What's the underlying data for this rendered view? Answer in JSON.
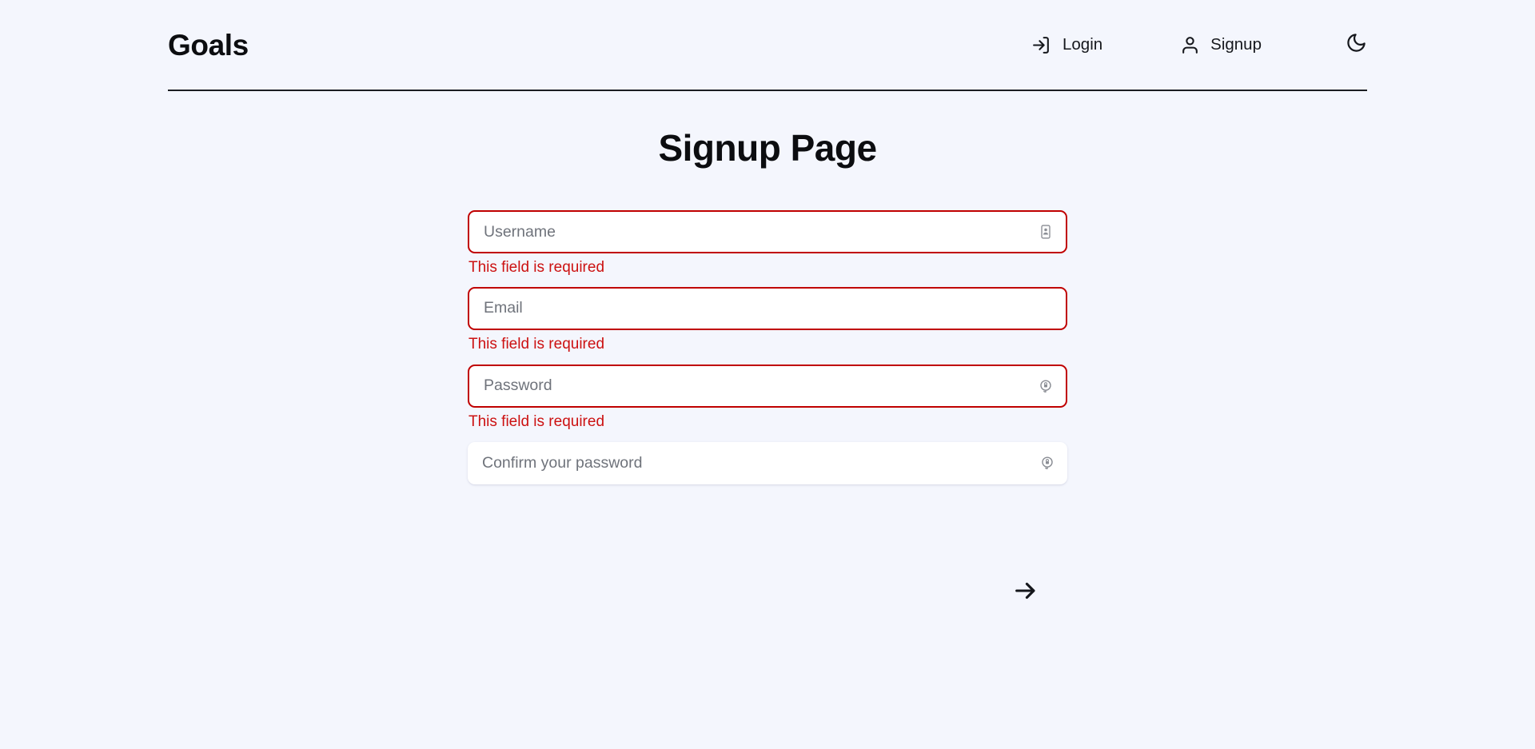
{
  "theme": {
    "background": "#f4f6fd",
    "surface": "#ffffff",
    "text": "#0c0d10",
    "error_border": "#c00000",
    "error_text": "#cc1111",
    "placeholder": "#6f737b",
    "divider": "#1b1d22"
  },
  "header": {
    "brand": "Goals",
    "nav": [
      {
        "label": "Login",
        "icon": "log-in-icon"
      },
      {
        "label": "Signup",
        "icon": "user-icon"
      }
    ],
    "theme_toggle": {
      "icon": "moon-icon",
      "label": "Dark mode"
    }
  },
  "main": {
    "title": "Signup Page",
    "fields": [
      {
        "name": "username",
        "placeholder": "Username",
        "value": "",
        "type": "text",
        "state": "error",
        "error": "This field is required",
        "affordance_icon": "contact-card-icon"
      },
      {
        "name": "email",
        "placeholder": "Email",
        "value": "",
        "type": "email",
        "state": "error",
        "error": "This field is required",
        "affordance_icon": ""
      },
      {
        "name": "password",
        "placeholder": "Password",
        "value": "",
        "type": "password",
        "state": "error",
        "error": "This field is required",
        "affordance_icon": "key-autofill-icon"
      },
      {
        "name": "confirm-password",
        "placeholder": "Confirm your password",
        "value": "",
        "type": "password",
        "state": "ok",
        "error": "",
        "affordance_icon": "key-autofill-icon"
      }
    ],
    "submit": {
      "icon": "arrow-right-icon",
      "label": "Submit"
    }
  }
}
